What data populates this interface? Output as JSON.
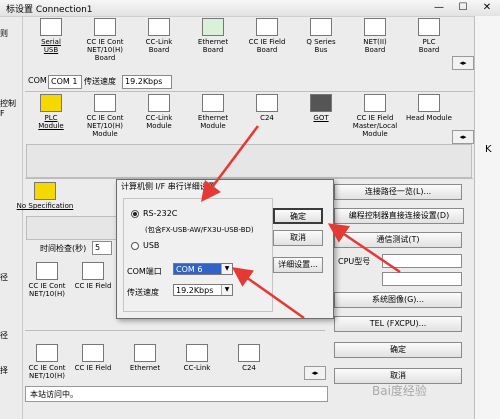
{
  "window": {
    "title": "标设置 Connection1"
  },
  "side_labels": [
    "则",
    "控制\nF",
    "径",
    "径",
    "择"
  ],
  "pc_if_row": [
    {
      "label": "Serial\nUSB",
      "underline": true,
      "icon": "serial-usb-icon"
    },
    {
      "label": "CC IE Cont\nNET/10(H)\nBoard",
      "underline": false,
      "icon": "cc-ie-cont-board-icon"
    },
    {
      "label": "CC-Link\nBoard",
      "underline": false,
      "icon": "cc-link-board-icon"
    },
    {
      "label": "Ethernet\nBoard",
      "underline": false,
      "icon": "ethernet-board-icon"
    },
    {
      "label": "CC IE Field\nBoard",
      "underline": false,
      "icon": "cc-ie-field-board-icon"
    },
    {
      "label": "Q Series\nBus",
      "underline": false,
      "icon": "q-series-bus-icon"
    },
    {
      "label": "NET(II)\nBoard",
      "underline": false,
      "icon": "net-ii-board-icon"
    },
    {
      "label": "PLC\nBoard",
      "underline": false,
      "icon": "plc-board-icon"
    }
  ],
  "com_row": {
    "com_label": "COM",
    "com_value": "COM 1",
    "speed_label": "传送速度",
    "speed_value": "19.2Kbps"
  },
  "plc_if_row": [
    {
      "label": "PLC\nModule",
      "underline": true,
      "icon": "plc-module-icon"
    },
    {
      "label": "CC IE Cont\nNET/10(H)\nModule",
      "underline": false,
      "icon": "cc-ie-cont-module-icon"
    },
    {
      "label": "CC-Link\nModule",
      "underline": false,
      "icon": "cc-link-module-icon"
    },
    {
      "label": "Ethernet\nModule",
      "underline": false,
      "icon": "ethernet-module-icon"
    },
    {
      "label": "C24",
      "underline": false,
      "icon": "c24-icon"
    },
    {
      "label": "GOT",
      "underline": true,
      "icon": "got-icon"
    },
    {
      "label": "CC IE Field\nMaster/Local\nModule",
      "underline": false,
      "icon": "cc-ie-field-master-icon"
    },
    {
      "label": "Head Module",
      "underline": false,
      "icon": "head-module-icon"
    }
  ],
  "other_station": {
    "label": "No Specification"
  },
  "time_check": {
    "label": "时间检查(秒)",
    "value": "5"
  },
  "route_row1": [
    {
      "label": "CC IE Cont\nNET/10(H)"
    },
    {
      "label": "CC IE Field"
    }
  ],
  "route_row2": [
    {
      "label": "CC IE Cont\nNET/10(H)"
    },
    {
      "label": "CC IE Field"
    },
    {
      "label": "Ethernet"
    },
    {
      "label": "CC-Link"
    },
    {
      "label": "C24"
    }
  ],
  "status": {
    "text": "本站访问中。"
  },
  "right_buttons": {
    "path_list": "连接路径一览(L)...",
    "direct_connect": "编程控制器直接连接设置(D)",
    "comm_test": "通信测试(T)",
    "cpu_model": "CPU型号",
    "system_image": "系统图像(G)...",
    "tel": "TEL (FXCPU)...",
    "ok": "确定",
    "cancel": "取消"
  },
  "dialog": {
    "title": "计算机侧 I/F 串行详细设置",
    "rs232c": "RS-232C",
    "rs232c_note": "(包含FX-USB-AW/FX3U-USB-BD)",
    "usb": "USB",
    "com_port_label": "COM端口",
    "com_port_value": "COM 6",
    "speed_label": "传送速度",
    "speed_value": "19.2Kbps",
    "ok": "确定",
    "cancel": "取消",
    "detail": "详细设置..."
  },
  "watermark": "Bai度经验",
  "colors": {
    "accent": "#2f64c6",
    "arrow": "#e53935",
    "panel": "#ececec"
  }
}
